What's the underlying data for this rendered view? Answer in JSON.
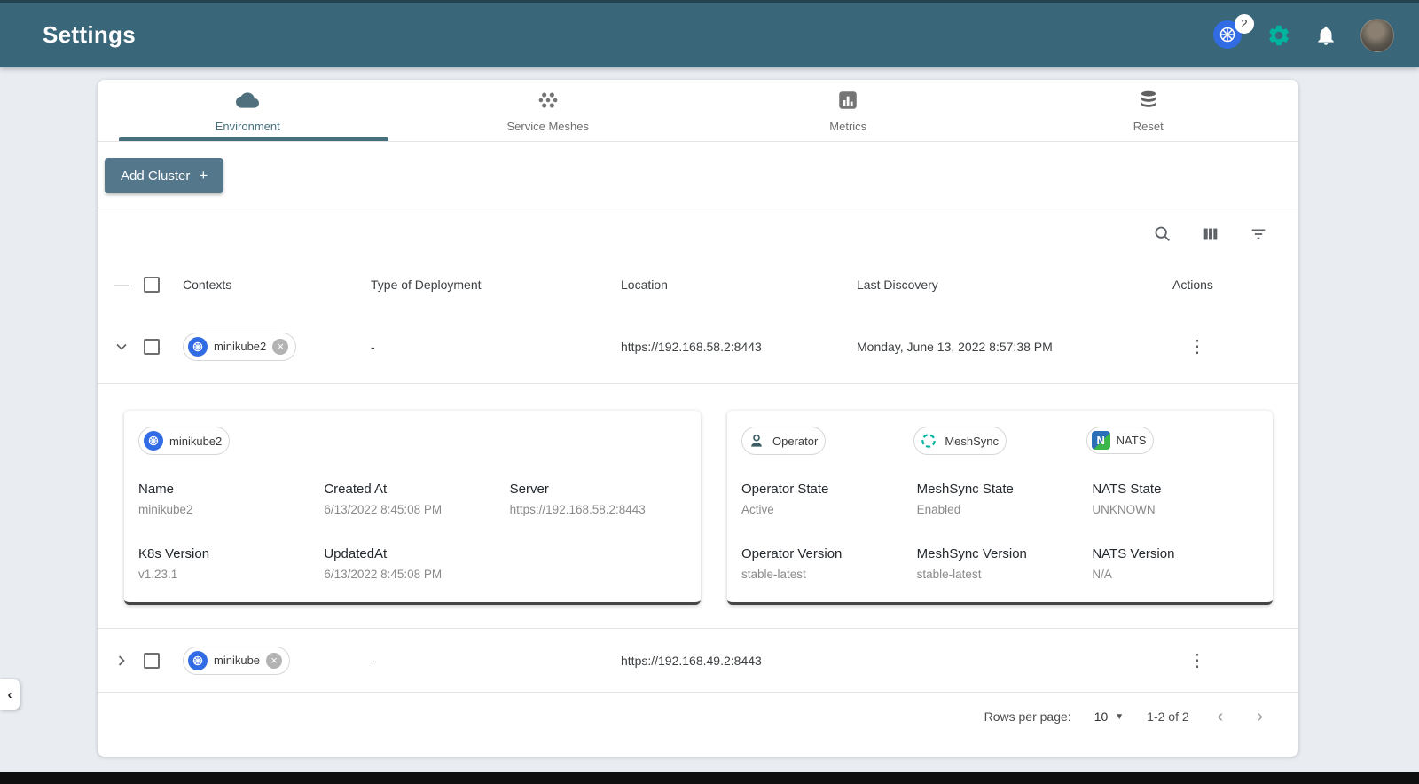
{
  "colors": {
    "header_bg": "#396679",
    "accent_green": "#00b39f",
    "add_button_bg": "#54778c",
    "k8s_blue": "#326ce5",
    "tab_active": "#47707f"
  },
  "header": {
    "title": "Settings",
    "k8s_badge": "2"
  },
  "tabs": [
    {
      "label": "Environment",
      "icon": "cloud-icon",
      "active": true
    },
    {
      "label": "Service Meshes",
      "icon": "mesh-icon",
      "active": false
    },
    {
      "label": "Metrics",
      "icon": "bar-chart-icon",
      "active": false
    },
    {
      "label": "Reset",
      "icon": "database-icon",
      "active": false
    }
  ],
  "actions_bar": {
    "add_cluster_label": "Add Cluster",
    "plus": "+"
  },
  "table": {
    "columns": [
      "Contexts",
      "Type of Deployment",
      "Location",
      "Last Discovery",
      "Actions"
    ],
    "rows": [
      {
        "context": "minikube2",
        "deployment_type": "-",
        "location": "https://192.168.58.2:8443",
        "last_discovery": "Monday, June 13, 2022 8:57:38 PM"
      },
      {
        "context": "minikube",
        "deployment_type": "-",
        "location": "https://192.168.49.2:8443",
        "last_discovery": ""
      }
    ]
  },
  "details": {
    "cluster_chip": "minikube2",
    "fields": [
      {
        "label": "Name",
        "value": "minikube2"
      },
      {
        "label": "Created At",
        "value": "6/13/2022 8:45:08 PM"
      },
      {
        "label": "Server",
        "value": "https://192.168.58.2:8443"
      },
      {
        "label": "K8s Version",
        "value": "v1.23.1"
      },
      {
        "label": "UpdatedAt",
        "value": "6/13/2022 8:45:08 PM"
      }
    ],
    "operator": {
      "chips": [
        "Operator",
        "MeshSync",
        "NATS"
      ],
      "nats_letter": "N",
      "fields": [
        {
          "label": "Operator State",
          "value": "Active"
        },
        {
          "label": "MeshSync State",
          "value": "Enabled"
        },
        {
          "label": "NATS State",
          "value": "UNKNOWN"
        },
        {
          "label": "Operator Version",
          "value": "stable-latest"
        },
        {
          "label": "MeshSync Version",
          "value": "stable-latest"
        },
        {
          "label": "NATS Version",
          "value": "N/A"
        }
      ]
    }
  },
  "pagination": {
    "rows_per_page_label": "Rows per page:",
    "rows_per_page_value": "10",
    "range": "1-2 of 2"
  },
  "edge_handle_glyph": "‹"
}
